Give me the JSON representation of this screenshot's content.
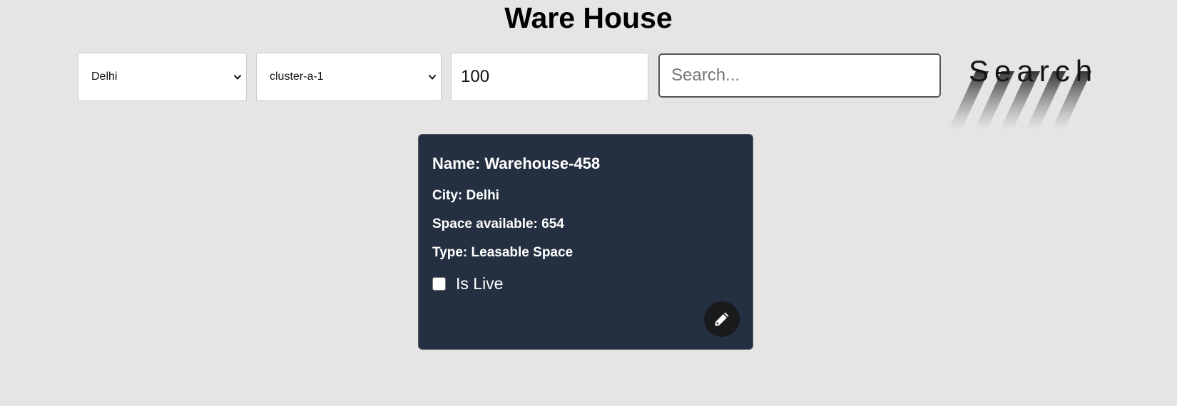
{
  "header": {
    "title": "Ware House"
  },
  "filters": {
    "city": {
      "selected": "Delhi"
    },
    "cluster": {
      "selected": "cluster-a-1"
    },
    "space": {
      "value": "100"
    },
    "search": {
      "placeholder": "Search..."
    },
    "search_button_label": "Search"
  },
  "card": {
    "name": "Name: Warehouse-458",
    "city": "City: Delhi",
    "space": "Space available: 654",
    "type": "Type: Leasable Space",
    "is_live_label": "Is Live",
    "is_live_checked": false,
    "background": "#243042"
  },
  "icons": {
    "edit": "pencil-icon",
    "dropdown": "chevron-down-icon"
  }
}
